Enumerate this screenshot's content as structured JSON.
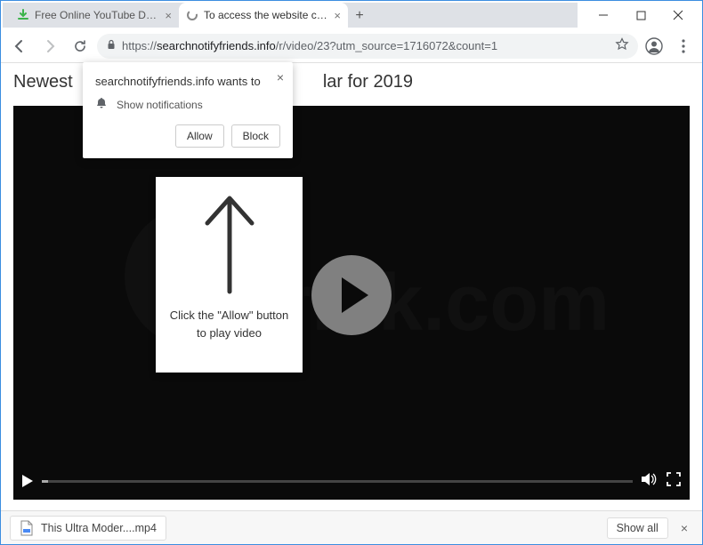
{
  "tabs": [
    {
      "title": "Free Online YouTube Downloade"
    },
    {
      "title": "To access the website click the \"A"
    }
  ],
  "url": {
    "scheme": "https://",
    "host": "searchnotifyfriends.info",
    "path": "/r/video/23?utm_source=1716072&count=1"
  },
  "page": {
    "header_prefix": "Newest",
    "header_suffix": "lar for 2019"
  },
  "card": {
    "line1": "Click the \"Allow\" button",
    "line2": "to play video"
  },
  "perm": {
    "title": "searchnotifyfriends.info wants to",
    "notif_label": "Show notifications",
    "allow": "Allow",
    "block": "Block"
  },
  "downloads": {
    "file_label": "This Ultra Moder....mp4",
    "show_all": "Show all"
  },
  "watermark": {
    "text": "risk.com"
  }
}
